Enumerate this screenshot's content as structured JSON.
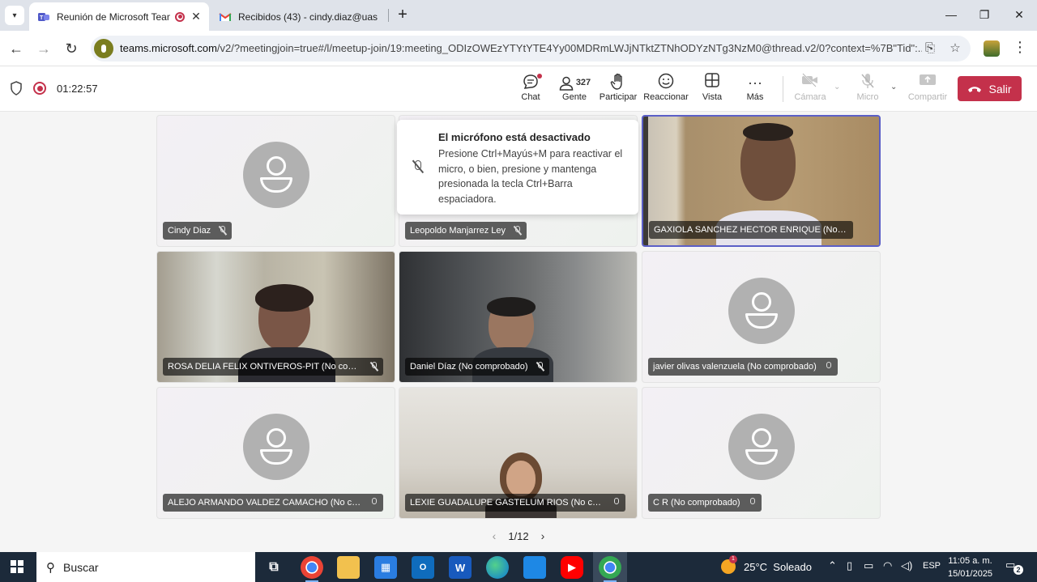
{
  "browser": {
    "tabs": [
      {
        "title": "Reunión de Microsoft Teams",
        "active": true
      },
      {
        "title": "Recibidos (43) - cindy.diaz@uas",
        "active": false
      }
    ],
    "url_host": "teams.microsoft.com",
    "url_path": "/v2/?meetingjoin=true#/l/meetup-join/19:meeting_ODIzOWEzYTYtYTE4Yy00MDRmLWJjNTktZTNhODYzNTg3NzM0@thread.v2/0?context=%7B\"Tid\":..."
  },
  "meeting": {
    "timer": "01:22:57",
    "toolbar": {
      "chat": "Chat",
      "people": "Gente",
      "people_count": "327",
      "raise": "Participar",
      "react": "Reaccionar",
      "view": "Vista",
      "more": "Más",
      "camera": "Cámara",
      "mic": "Micro",
      "share": "Compartir",
      "leave": "Salir"
    },
    "toast": {
      "title": "El micrófono está desactivado",
      "body": "Presione Ctrl+Mayús+M para reactivar el micro, o bien, presione y mantenga presionada la tecla Ctrl+Barra espaciadora."
    },
    "participants": [
      {
        "name": "Cindy Diaz"
      },
      {
        "name": "Leopoldo Manjarrez Ley"
      },
      {
        "name": "GAXIOLA SANCHEZ HECTOR ENRIQUE (No compr..."
      },
      {
        "name": "ROSA DELIA FELIX ONTIVEROS-PIT (No compr..."
      },
      {
        "name": "Daniel Díaz (No comprobado)"
      },
      {
        "name": "javier olivas valenzuela (No comprobado)"
      },
      {
        "name": "ALEJO ARMANDO VALDEZ CAMACHO (No co..."
      },
      {
        "name": "LEXIE GUADALUPE GASTELUM RIOS (No comp..."
      },
      {
        "name": "C R (No comprobado)"
      }
    ],
    "pager": "1/12"
  },
  "taskbar": {
    "search": "Buscar",
    "weather": "25°C  Soleado",
    "weather_badge": "1",
    "lang": "ESP",
    "time": "11:05 a. m.",
    "date": "15/01/2025",
    "notifications": "2",
    "app_word": "W"
  },
  "colors": {
    "teams_purple": "#5b5fc7",
    "leave_red": "#c4314b",
    "taskbar": "#1c2a3a"
  }
}
